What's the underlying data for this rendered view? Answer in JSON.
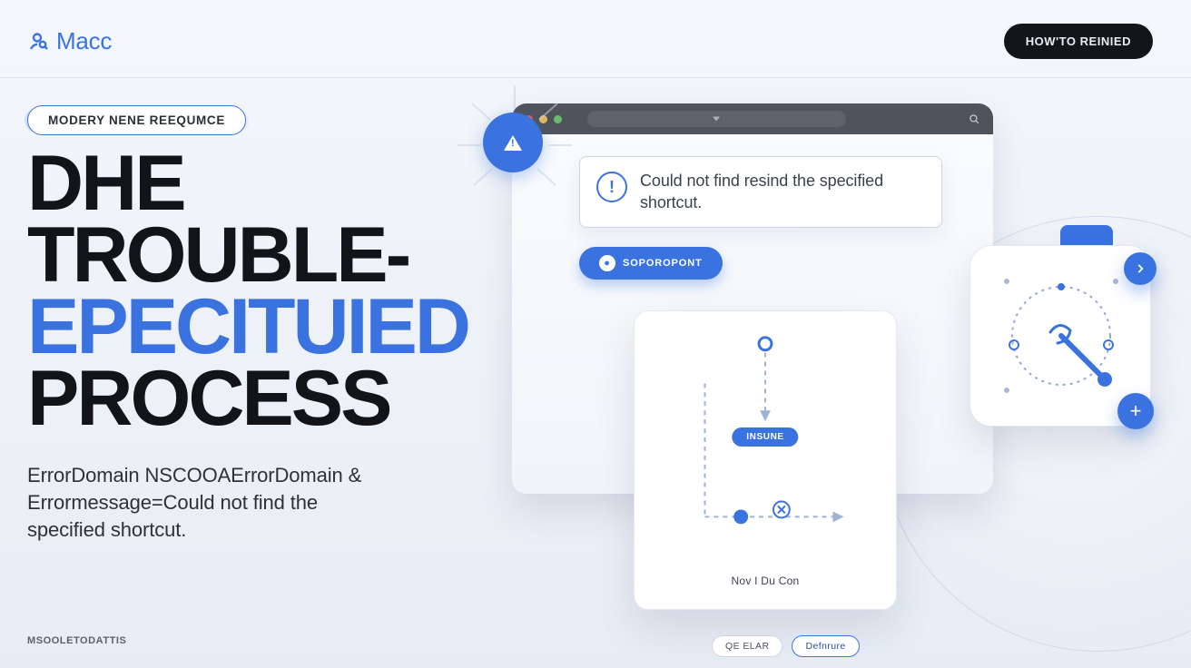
{
  "header": {
    "brand": "Macc",
    "cta_label": "HOW'TO REINIED"
  },
  "hero": {
    "pill": "MODERY NENE REEQUMCE",
    "title_line1": "DHE",
    "title_line2": "TROUBLE-",
    "title_line3": "EPECITUIED",
    "title_line4": "PROCESS",
    "sub_line1": "ErrorDomain NSCOOAErrorDomain &",
    "sub_line2": "Errormessage=Could not find the",
    "sub_line3": "specified shortcut."
  },
  "mock": {
    "dialog_message": "Could not find resind the specified shortcut.",
    "report_label": "SOPOROPONT",
    "flow_pill": "INSUNE",
    "you_can": "Nov I Du Con",
    "chip_a": "QE ELAR",
    "chip_b": "Defnrure",
    "traffic_colors": {
      "close": "#e0625c",
      "min": "#e6b95a",
      "max": "#6abb6b"
    }
  },
  "footer": {
    "tag": "MSOOLETODATTIS"
  },
  "colors": {
    "accent": "#3a73e0"
  }
}
